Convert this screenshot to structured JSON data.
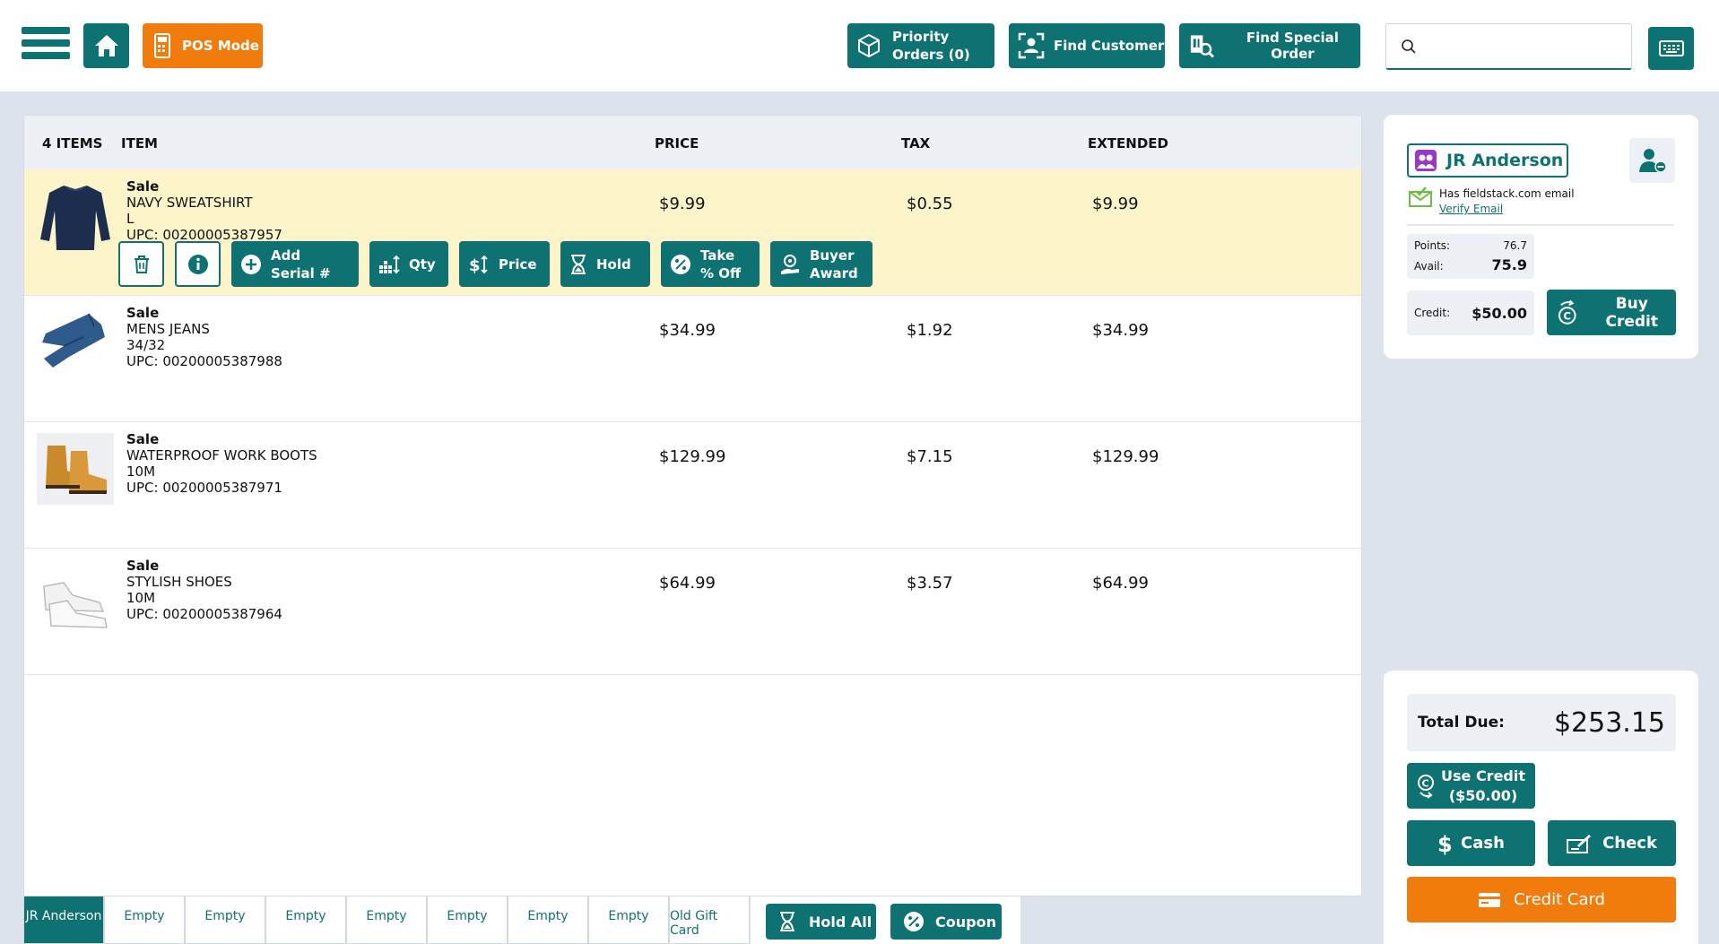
{
  "header": {
    "pos_mode": "POS Mode",
    "priority_line1": "Priority",
    "priority_line2": "Orders (0)",
    "find_customer": "Find Customer",
    "find_special_order": "Find Special Order",
    "search_value": ""
  },
  "cart": {
    "columns": {
      "count": "4 ITEMS",
      "item": "ITEM",
      "price": "PRICE",
      "tax": "TAX",
      "extended": "EXTENDED"
    },
    "items": [
      {
        "kind": "Sale",
        "name": "NAVY SWEATSHIRT",
        "variant": "L",
        "upc": "UPC: 00200005387957",
        "price": "$9.99",
        "tax": "$0.55",
        "extended": "$9.99",
        "icon": "sweatshirt-icon"
      },
      {
        "kind": "Sale",
        "name": "MENS JEANS",
        "variant": "34/32",
        "upc": "UPC: 00200005387988",
        "price": "$34.99",
        "tax": "$1.92",
        "extended": "$34.99",
        "icon": "jeans-icon"
      },
      {
        "kind": "Sale",
        "name": "WATERPROOF WORK BOOTS",
        "variant": "10M",
        "upc": "UPC: 00200005387971",
        "price": "$129.99",
        "tax": "$7.15",
        "extended": "$129.99",
        "icon": "boots-icon"
      },
      {
        "kind": "Sale",
        "name": "STYLISH SHOES",
        "variant": "10M",
        "upc": "UPC: 00200005387964",
        "price": "$64.99",
        "tax": "$3.57",
        "extended": "$64.99",
        "icon": "shoes-icon"
      }
    ],
    "actions": {
      "add_serial_1": "Add",
      "add_serial_2": "Serial #",
      "qty": "Qty",
      "price": "Price",
      "hold": "Hold",
      "take_off_1": "Take",
      "take_off_2": "% Off",
      "buyer_award_1": "Buyer",
      "buyer_award_2": "Award"
    }
  },
  "tabs": [
    "JR Anderson",
    "Empty",
    "Empty",
    "Empty",
    "Empty",
    "Empty",
    "Empty",
    "Empty",
    "Old Gift Card"
  ],
  "bottom": {
    "hold_all": "Hold All",
    "coupon": "Coupon"
  },
  "customer": {
    "name": "JR Anderson",
    "email_note": "Has fieldstack.com email",
    "verify_link": "Verify Email",
    "points_label": "Points:",
    "points_value": "76.7",
    "avail_label": "Avail:",
    "avail_value": "75.9",
    "credit_label": "Credit:",
    "credit_value": "$50.00",
    "buy_credit": "Buy Credit"
  },
  "payment": {
    "total_label": "Total Due:",
    "total_value": "$253.15",
    "use_credit_1": "Use Credit",
    "use_credit_2": "($50.00)",
    "cash": "Cash",
    "check": "Check",
    "credit_card": "Credit Card"
  },
  "colors": {
    "brand": "#0f7272",
    "accent": "#f07c0e",
    "selected_row": "#fdf5c9"
  }
}
